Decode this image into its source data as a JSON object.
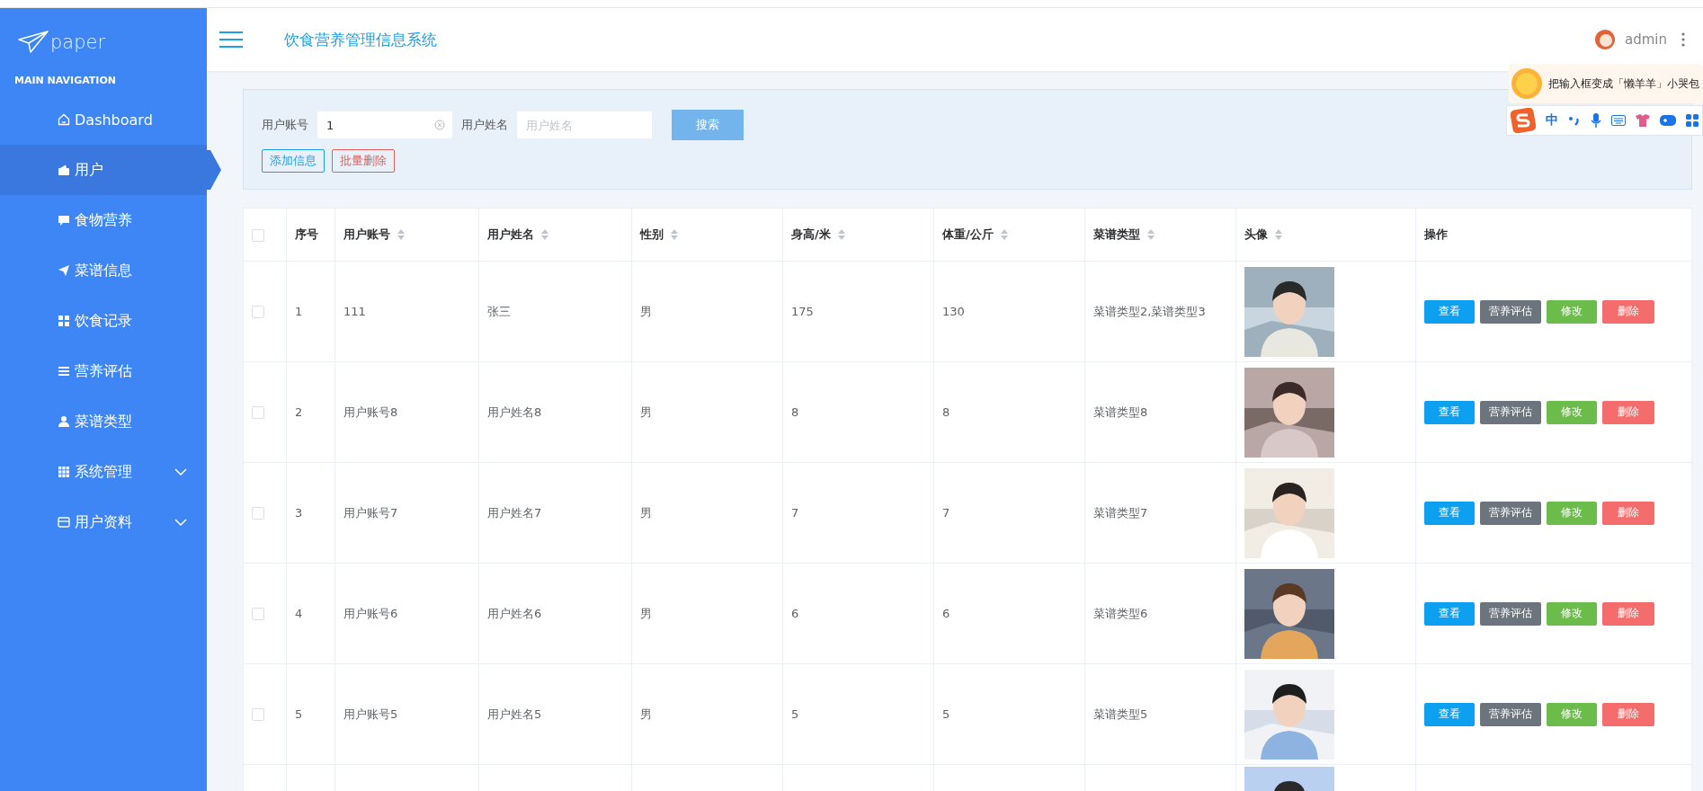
{
  "sidebar": {
    "logo": "paper",
    "section": "MAIN NAVIGATION",
    "items": [
      {
        "label": "Dashboard",
        "selected": false,
        "has_submenu": false
      },
      {
        "label": "用户",
        "selected": true,
        "has_submenu": false
      },
      {
        "label": "食物营养",
        "selected": false,
        "has_submenu": false
      },
      {
        "label": "菜谱信息",
        "selected": false,
        "has_submenu": false
      },
      {
        "label": "饮食记录",
        "selected": false,
        "has_submenu": false
      },
      {
        "label": "营养评估",
        "selected": false,
        "has_submenu": false
      },
      {
        "label": "菜谱类型",
        "selected": false,
        "has_submenu": false
      },
      {
        "label": "系统管理",
        "selected": false,
        "has_submenu": true
      },
      {
        "label": "用户资料",
        "selected": false,
        "has_submenu": true
      }
    ]
  },
  "header": {
    "title": "饮食营养管理信息系统",
    "user": "admin"
  },
  "ime": {
    "tip": "把输入框变成「懒羊羊」小哭包",
    "mode": "中"
  },
  "search": {
    "fields": [
      {
        "label": "用户账号",
        "value": "1"
      },
      {
        "label": "用户姓名",
        "placeholder": "用户姓名"
      }
    ],
    "button": "搜索",
    "actions": [
      "添加信息",
      "批量删除"
    ]
  },
  "table": {
    "header_checked": false,
    "columns": [
      {
        "label": "序号",
        "sortable": false
      },
      {
        "label": "用户账号",
        "sortable": true
      },
      {
        "label": "用户姓名",
        "sortable": true
      },
      {
        "label": "性别",
        "sortable": true
      },
      {
        "label": "身高/米",
        "sortable": true
      },
      {
        "label": "体重/公斤",
        "sortable": true
      },
      {
        "label": "菜谱类型",
        "sortable": true
      },
      {
        "label": "头像",
        "sortable": true
      },
      {
        "label": "操作",
        "sortable": false
      }
    ],
    "rows": [
      {
        "checked": false,
        "cells": [
          "1",
          "111",
          "张三",
          "男",
          "175",
          "130",
          "菜谱类型2,菜谱类型3"
        ],
        "avatar": {
          "kind": "picture"
        },
        "actions": [
          "查看",
          "营养评估",
          "修改",
          "删除"
        ]
      },
      {
        "checked": false,
        "cells": [
          "2",
          "用户账号8",
          "用户姓名8",
          "男",
          "8",
          "8",
          "菜谱类型8"
        ],
        "avatar": {
          "kind": "picture"
        },
        "actions": [
          "查看",
          "营养评估",
          "修改",
          "删除"
        ]
      },
      {
        "checked": false,
        "cells": [
          "3",
          "用户账号7",
          "用户姓名7",
          "男",
          "7",
          "7",
          "菜谱类型7"
        ],
        "avatar": {
          "kind": "picture"
        },
        "actions": [
          "查看",
          "营养评估",
          "修改",
          "删除"
        ]
      },
      {
        "checked": false,
        "cells": [
          "4",
          "用户账号6",
          "用户姓名6",
          "男",
          "6",
          "6",
          "菜谱类型6"
        ],
        "avatar": {
          "kind": "picture"
        },
        "actions": [
          "查看",
          "营养评估",
          "修改",
          "删除"
        ]
      },
      {
        "checked": false,
        "cells": [
          "5",
          "用户账号5",
          "用户姓名5",
          "男",
          "5",
          "5",
          "菜谱类型5"
        ],
        "avatar": {
          "kind": "picture"
        },
        "actions": [
          "查看",
          "营养评估",
          "修改",
          "删除"
        ]
      }
    ]
  }
}
